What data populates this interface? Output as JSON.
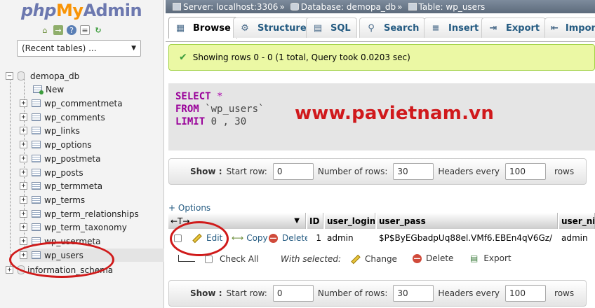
{
  "logo": {
    "php": "php",
    "my": "My",
    "admin": "Admin"
  },
  "nav_icons": [
    "home-icon",
    "logout-icon",
    "help-icon",
    "docs-icon",
    "reload-icon"
  ],
  "recent_tables": {
    "selected": "(Recent tables) ..."
  },
  "tree": {
    "database": "demopa_db",
    "new_label": "New",
    "tables": [
      "wp_commentmeta",
      "wp_comments",
      "wp_links",
      "wp_options",
      "wp_postmeta",
      "wp_posts",
      "wp_termmeta",
      "wp_terms",
      "wp_term_relationships",
      "wp_term_taxonomy",
      "wp_usermeta",
      "wp_users"
    ],
    "other_database": "information_schema"
  },
  "breadcrumb": {
    "server": "Server: localhost:3306",
    "database": "Database: demopa_db",
    "table": "Table: wp_users",
    "separator": "»"
  },
  "tabs": [
    {
      "label": "Browse",
      "icon": "browse-icon"
    },
    {
      "label": "Structure",
      "icon": "structure-icon"
    },
    {
      "label": "SQL",
      "icon": "sql-icon"
    },
    {
      "label": "Search",
      "icon": "search-icon"
    },
    {
      "label": "Insert",
      "icon": "insert-icon"
    },
    {
      "label": "Export",
      "icon": "export-icon"
    },
    {
      "label": "Impor",
      "icon": "import-icon"
    }
  ],
  "success_message": "Showing rows 0 - 0 (1 total, Query took 0.0203 sec)",
  "sql": {
    "select": "SELECT",
    "star": "*",
    "from": "FROM",
    "table": "`wp_users`",
    "limit": "LIMIT",
    "limit_args": "0 , 30"
  },
  "watermark": "www.pavietnam.vn",
  "navigation_bar": {
    "show_label": "Show :",
    "start_row_label": "Start row:",
    "start_row_value": "0",
    "rows_label": "Number of rows:",
    "rows_value": "30",
    "headers_label": "Headers every",
    "headers_value": "100",
    "rows_suffix": "rows"
  },
  "options_link": "+ Options",
  "grid": {
    "columns": [
      "ID",
      "user_login",
      "user_pass",
      "user_nic"
    ],
    "sort_arrow": "▼",
    "row": {
      "edit": "Edit",
      "copy": "Copy",
      "delete": "Delete",
      "id": "1",
      "user_login": "admin",
      "user_pass": "$P$ByEGbadpUq88el.VMf6.EBEn4qV6Gz/",
      "user_nicename": "admin"
    }
  },
  "bulk_actions": {
    "check_all": "Check All",
    "with_selected": "With selected:",
    "change": "Change",
    "delete": "Delete",
    "export": "Export"
  },
  "colors": {
    "annotation_red": "#d01a1a",
    "success_bg": "#ebf8a4",
    "link_blue": "#235a81",
    "sql_keyword": "#990099"
  }
}
